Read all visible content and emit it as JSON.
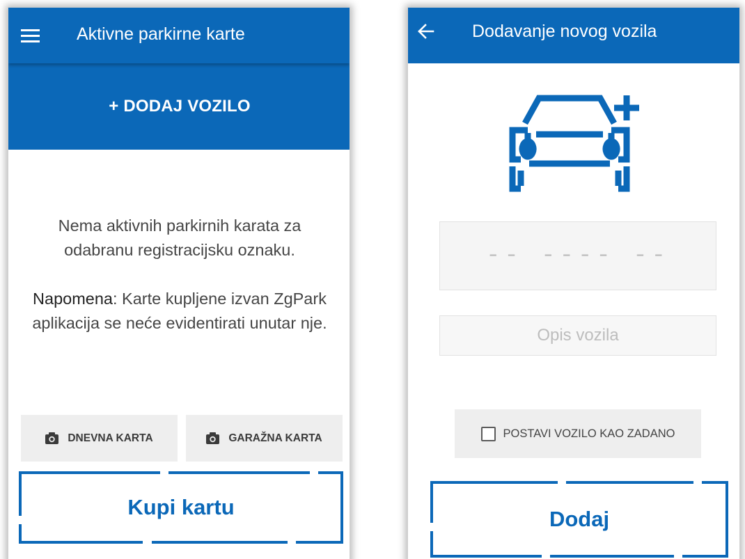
{
  "left_screen": {
    "appbar": {
      "title": "Aktivne parkirne karte",
      "menu_icon": "menu-icon"
    },
    "add_vehicle_label": "+ DODAJ VOZILO",
    "empty_message": {
      "line1": "Nema aktivnih parkirnih karata za odabranu registracijsku oznaku.",
      "note_label": "Napomena",
      "note_text": ": Karte kupljene izvan ZgPark aplikacija se neće evidentirati unutar nje."
    },
    "daily_ticket": {
      "label": "DNEVNA KARTA",
      "icon": "camera-icon"
    },
    "garage_ticket": {
      "label": "GARAŽNA KARTA",
      "icon": "camera-icon"
    },
    "buy_ticket_label": "Kupi kartu"
  },
  "right_screen": {
    "appbar": {
      "title": "Dodavanje novog vozila",
      "back_icon": "arrow-left-icon"
    },
    "illustration": "car-add-icon",
    "plate_placeholder": "-- ---- --",
    "description_placeholder": "Opis vozila",
    "default_checkbox_label": "POSTAVI VOZILO KAO ZADANO",
    "default_checked": false,
    "add_label": "Dodaj"
  },
  "colors": {
    "primary_blue": "#0b68b8",
    "button_gray": "#eeeeee",
    "text_gray": "#454545"
  }
}
